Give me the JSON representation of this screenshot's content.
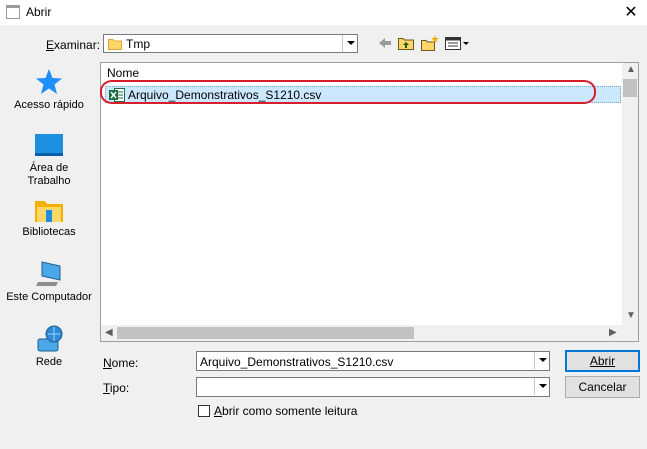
{
  "window": {
    "title": "Abrir",
    "close_glyph": "✕"
  },
  "toolbar": {
    "look_in_label": "Examinar:",
    "look_in_value": "Tmp",
    "icons": [
      "back-arrow-icon",
      "up-folder-icon",
      "new-folder-icon",
      "view-menu-icon"
    ]
  },
  "sidebar": {
    "items": [
      {
        "label": "Acesso rápido",
        "icon": "star-icon"
      },
      {
        "label": "Área de Trabalho",
        "icon": "desktop-icon"
      },
      {
        "label": "Bibliotecas",
        "icon": "libraries-icon"
      },
      {
        "label": "Este Computador",
        "icon": "computer-icon"
      },
      {
        "label": "Rede",
        "icon": "network-icon"
      }
    ]
  },
  "filelist": {
    "column_header": "Nome",
    "files": [
      {
        "name": "Arquivo_Demonstrativos_S1210.csv",
        "icon": "excel-file-icon",
        "selected": true
      }
    ]
  },
  "form": {
    "filename_label": "Nome:",
    "filename_value": "Arquivo_Demonstrativos_S1210.csv",
    "type_label": "Tipo:",
    "type_value": "",
    "readonly_label": "Abrir como somente leitura",
    "readonly_checked": false
  },
  "buttons": {
    "open": "Abrir",
    "cancel": "Cancelar"
  },
  "colors": {
    "selection": "#cce8ff",
    "highlight_ring": "#d81e2c",
    "accent": "#0078d7"
  }
}
